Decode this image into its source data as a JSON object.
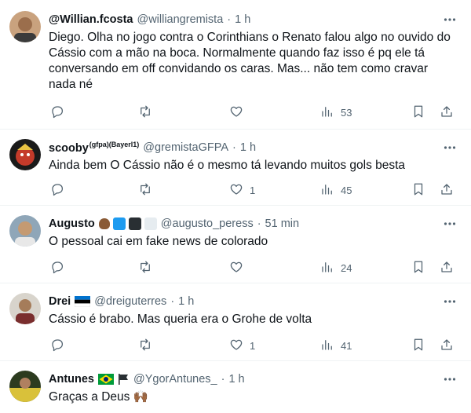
{
  "tweets": [
    {
      "name": "@Willian.fcosta",
      "name_sup": "",
      "handle": "@williangremista",
      "time": "1 h",
      "text": "Diego. Olha no jogo contra o Corinthians o Renato falou algo no ouvido do Cássio com a mão na boca. Normalmente quando faz isso é pq ele tá conversando em off convidando os caras. Mas... não tem como cravar nada né",
      "likes": "",
      "views": "53"
    },
    {
      "name": "scooby",
      "name_sup": "(gfpa)(Bayerl1)",
      "handle": "@gremistaGFPA",
      "time": "1 h",
      "text": "Ainda bem O Cássio não é o mesmo tá levando muitos gols besta",
      "likes": "1",
      "views": "45"
    },
    {
      "name": "Augusto",
      "name_sup": "",
      "handle": "@augusto_peress",
      "time": "51 min",
      "text": "O pessoal cai em fake news de colorado",
      "likes": "",
      "views": "24"
    },
    {
      "name": "Drei",
      "name_sup": "",
      "handle": "@dreiguterres",
      "time": "1 h",
      "text": "Cássio é brabo. Mas queria era o Grohe de volta",
      "likes": "1",
      "views": "41"
    },
    {
      "name": "Antunes",
      "name_sup": "",
      "handle": "@YgorAntunes_",
      "time": "1 h",
      "text": "Graças a Deus 🙌🏾",
      "likes": "",
      "views": ""
    }
  ],
  "separator": "·",
  "icons": [
    "more-icon",
    "reply-icon",
    "retweet-icon",
    "like-icon",
    "views-icon",
    "bookmark-icon",
    "share-icon"
  ],
  "colors": {
    "text": "#0f1419",
    "secondary": "#536471",
    "divider": "#eff3f4",
    "flag_blue": "#1d9bf0"
  }
}
